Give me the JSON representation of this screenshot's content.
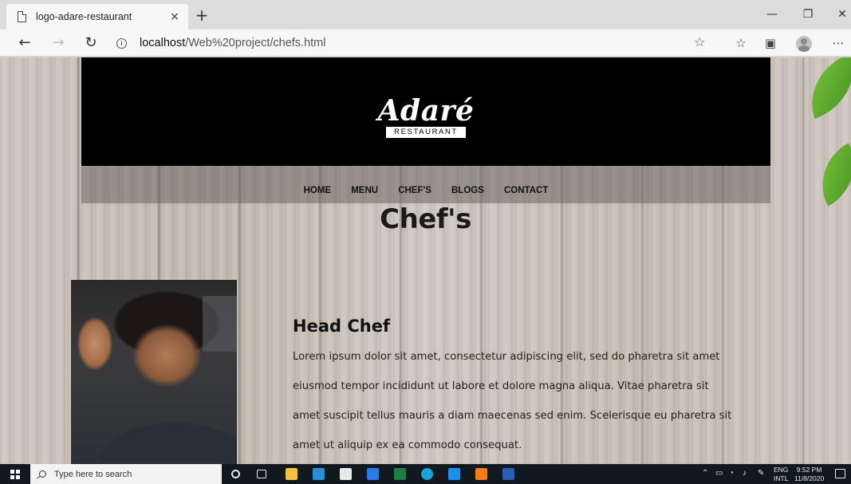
{
  "browser": {
    "tab_title": "logo-adare-restaurant",
    "tab_close": "×",
    "new_tab": "+",
    "url_host": "localhost",
    "url_path": "/Web%20project/chefs.html",
    "window_controls": {
      "minimize": "—",
      "restore": "❐",
      "close": "✕"
    },
    "nav": {
      "back": "←",
      "forward": "→",
      "refresh": "↻"
    },
    "toolbar_icons": [
      "favorite-star-icon",
      "favorites-icon",
      "collections-icon",
      "profile-icon",
      "more-icon"
    ],
    "more": "⋯"
  },
  "site": {
    "logo_text": "Adaré",
    "logo_sub": "RESTAURANT",
    "menu": [
      "HOME",
      "MENU",
      "CHEF'S",
      "BLOGS",
      "CONTACT"
    ],
    "page_title": "Chef's",
    "chef": {
      "role": "Head Chef",
      "bio": "Lorem ipsum dolor sit amet, consectetur adipiscing elit, sed do pharetra sit amet eiusmod tempor incididunt ut labore et dolore magna aliqua. Vitae pharetra sit amet suscipit tellus mauris a diam maecenas sed enim. Scelerisque eu pharetra sit amet ut aliquip ex ea commodo consequat."
    }
  },
  "taskbar": {
    "search_placeholder": "Type here to search",
    "lang_top": "ENG",
    "lang_bottom": "INTL",
    "time": "9:52 PM",
    "date": "11/8/2020"
  },
  "colors": {
    "header_bg": "#000000",
    "menu_bar": "#5f5852",
    "leaf_green": "#5faa2f",
    "taskbar_bg": "#101820"
  }
}
